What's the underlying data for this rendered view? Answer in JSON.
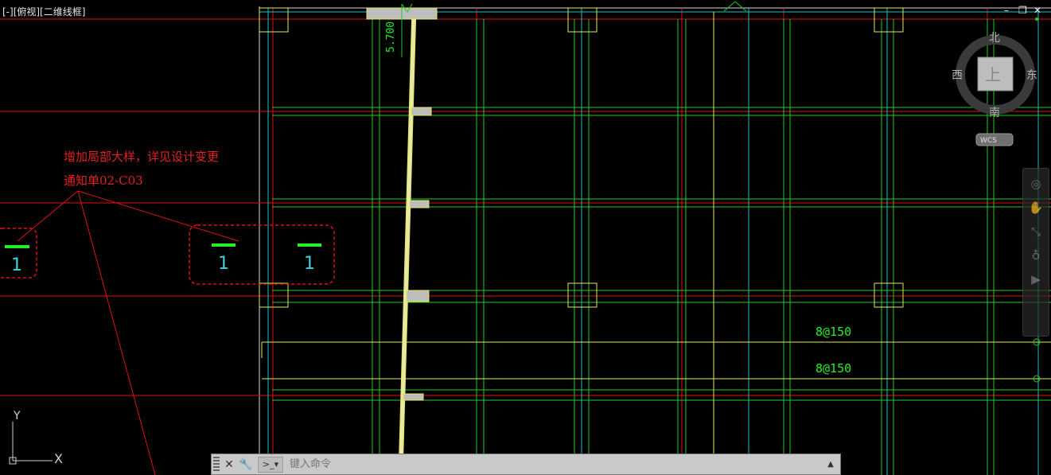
{
  "viewport": {
    "label": "[-][俯视][二维线框]"
  },
  "window_controls": {
    "minimize": "–",
    "restore": "❐",
    "close": "✕"
  },
  "viewcube": {
    "north": "北",
    "south": "南",
    "east": "东",
    "west": "西",
    "top": "上",
    "wcs": "WCS"
  },
  "drawing": {
    "level_mark": "5.700",
    "note_line1": "增加局部大样，详见设计变更",
    "note_line2": "通知单02-C03",
    "section_mark": "1",
    "rebar_label_1": "8@150",
    "rebar_label_2": "8@150"
  },
  "ucs": {
    "y_label": "Y",
    "x_label": "X"
  },
  "navbar": {
    "items": [
      "steering-wheel",
      "pan",
      "zoom",
      "orbit",
      "showmotion"
    ]
  },
  "command": {
    "placeholder": "键入命令"
  },
  "colors": {
    "grid_red": "#e01010",
    "beam_green": "#22cc22",
    "axis_cyan": "#20c0c0",
    "slab_yellow": "#e6e65a",
    "text_red": "#e62020",
    "text_green": "#22ee22",
    "text_cyan": "#40d0e0"
  }
}
